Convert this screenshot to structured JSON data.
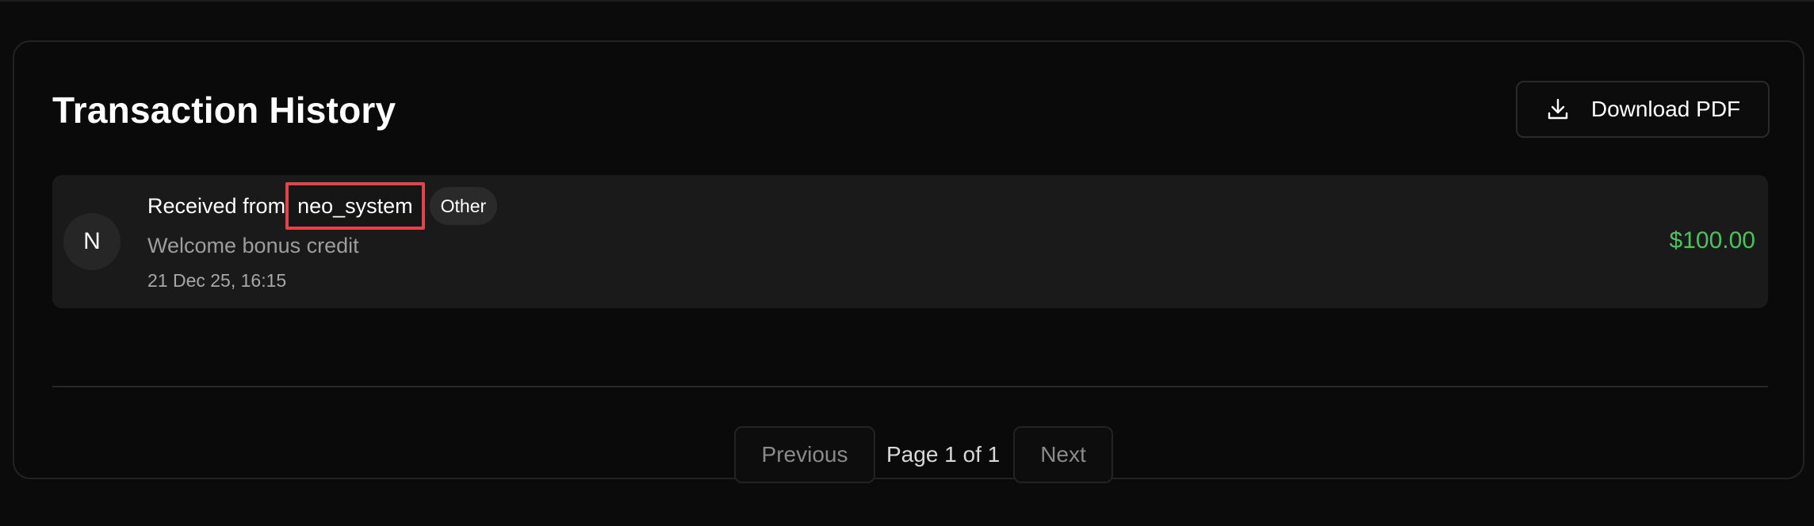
{
  "header": {
    "title": "Transaction History",
    "download_label": "Download PDF",
    "download_icon": "download-icon"
  },
  "transactions": [
    {
      "avatar_letter": "N",
      "prefix": "Received from",
      "counterparty": "neo_system",
      "tag": "Other",
      "description": "Welcome bonus credit",
      "date": "21 Dec 25, 16:15",
      "amount": "$100.00"
    }
  ],
  "pagination": {
    "previous_label": "Previous",
    "page_info": "Page 1 of 1",
    "next_label": "Next"
  },
  "colors": {
    "background": "#0b0b0b",
    "row": "#1a1a1a",
    "amount_positive": "#4bc35d",
    "highlight_box": "#e0454b"
  }
}
